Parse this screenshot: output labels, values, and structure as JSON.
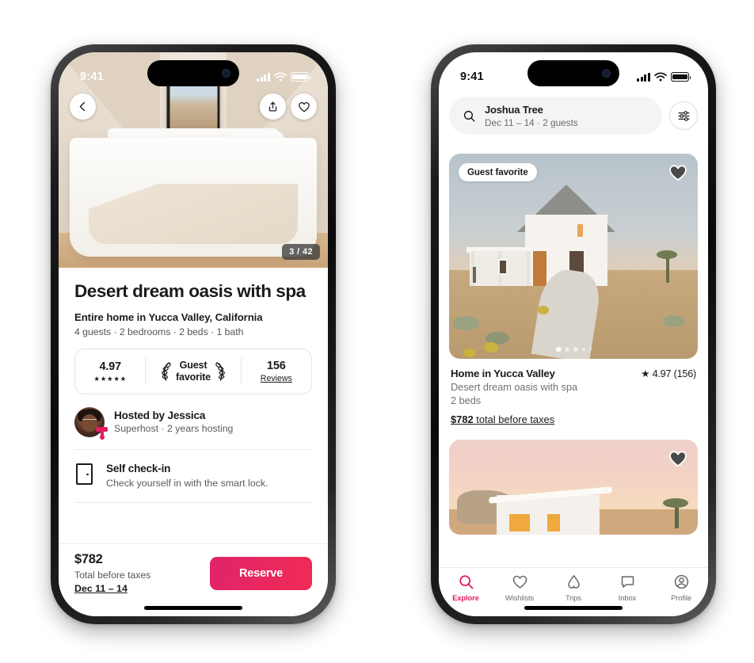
{
  "left_phone": {
    "status_bar": {
      "time": "9:41",
      "signal_icon": "cellular-bars-icon",
      "wifi_icon": "wifi-icon",
      "battery_icon": "battery-icon"
    },
    "hero": {
      "back_icon": "chevron-left-icon",
      "share_icon": "share-icon",
      "save_icon": "heart-outline-icon",
      "photo_counter": "3 / 42"
    },
    "listing": {
      "title": "Desert dream oasis with spa",
      "subtitle": "Entire home in Yucca Valley, California",
      "meta": "4 guests · 2 bedrooms · 2 beds · 1 bath"
    },
    "stats": {
      "rating_value": "4.97",
      "stars": "★★★★★",
      "badge_line1": "Guest",
      "badge_line2": "favorite",
      "laurel_icon": "laurel-wreath-icon",
      "reviews_value": "156",
      "reviews_label": "Reviews"
    },
    "host": {
      "avatar_icon": "host-avatar",
      "superhost_badge_icon": "superhost-badge-icon",
      "name": "Hosted by Jessica",
      "details": "Superhost · 2 years hosting"
    },
    "feature": {
      "icon": "door-icon",
      "title": "Self check-in",
      "description": "Check yourself in with the smart lock."
    },
    "booking_bar": {
      "price": "$782",
      "price_note": "Total before taxes",
      "dates": "Dec 11 – 14",
      "reserve_label": "Reserve",
      "reserve_color": "#e8275f"
    }
  },
  "right_phone": {
    "status_bar": {
      "time": "9:41",
      "signal_icon": "cellular-bars-icon",
      "wifi_icon": "wifi-icon",
      "battery_icon": "battery-icon"
    },
    "search": {
      "icon": "search-icon",
      "location": "Joshua Tree",
      "details": "Dec 11 – 14 · 2 guests",
      "filter_icon": "filter-sliders-icon"
    },
    "cards": [
      {
        "badge": "Guest favorite",
        "heart_icon": "heart-filled-icon",
        "title": "Home in Yucca Valley",
        "rating": "★ 4.97 (156)",
        "subtitle": "Desert dream oasis with spa",
        "beds": "2 beds",
        "price_strong": "$782",
        "price_rest": " total before taxes",
        "carousel_dots": 5,
        "carousel_active": 1
      },
      {
        "heart_icon": "heart-filled-icon"
      }
    ],
    "tabs": [
      {
        "label": "Explore",
        "icon": "search-icon",
        "active": true
      },
      {
        "label": "Wishlists",
        "icon": "heart-outline-icon",
        "active": false
      },
      {
        "label": "Trips",
        "icon": "airbnb-bellhop-icon",
        "active": false
      },
      {
        "label": "Inbox",
        "icon": "message-icon",
        "active": false
      },
      {
        "label": "Profile",
        "icon": "profile-icon",
        "active": false
      }
    ],
    "accent_color": "#e31c5f"
  }
}
